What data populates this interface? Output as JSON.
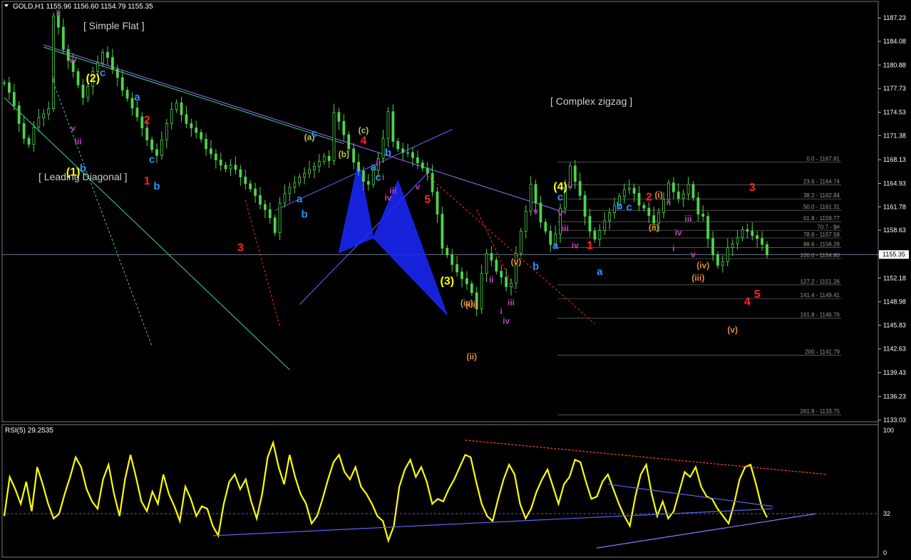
{
  "window": {
    "title": "GOLD,H1  1155.96 1156.60 1154.79 1155.35",
    "arrow_icon": "triangle-down-icon"
  },
  "colors": {
    "background": "#000000",
    "candle_up": "#4dd34d",
    "candle_dn": "#4dd34d",
    "rsi_line": "#ffff00",
    "wave_yellow": "#ffff00",
    "wave_red": "#ff2222",
    "wave_blue": "#2f8fff",
    "wave_magenta": "#c040c0",
    "wave_olive": "#b8c850",
    "wave_orange": "#e09030",
    "trend_green": "#3ad6a0",
    "trend_blue": "#5868ff",
    "trend_violet": "#a070ff",
    "harmonic_fill": "#1a28ff",
    "grid_line": "#606060"
  },
  "chart_data": [
    {
      "type": "candlestick",
      "symbol": "GOLD",
      "timeframe": "H1",
      "ohlc_current": {
        "open": 1155.96,
        "high": 1156.6,
        "low": 1154.79,
        "close": 1155.35
      },
      "ylim": [
        1133.0,
        1188.5
      ],
      "y_ticks": [
        1187.23,
        1184.08,
        1180.88,
        1177.73,
        1174.53,
        1171.38,
        1168.13,
        1164.93,
        1161.78,
        1158.63,
        1155.35,
        1152.18,
        1148.98,
        1145.83,
        1142.63,
        1139.43,
        1136.23,
        1133.03
      ],
      "current_price": 1155.35,
      "closes": [
        1178.5,
        1177.2,
        1175.4,
        1173.0,
        1171.0,
        1170.2,
        1172.5,
        1173.8,
        1174.3,
        1175.0,
        1187.5,
        1186.0,
        1183.0,
        1181.5,
        1180.0,
        1178.2,
        1176.5,
        1178.0,
        1180.0,
        1181.2,
        1182.6,
        1181.9,
        1180.3,
        1179.2,
        1177.5,
        1176.4,
        1175.1,
        1173.9,
        1172.4,
        1170.8,
        1169.5,
        1168.7,
        1170.8,
        1173.0,
        1174.9,
        1175.8,
        1174.2,
        1173.0,
        1172.4,
        1171.8,
        1170.9,
        1169.6,
        1168.9,
        1168.1,
        1167.4,
        1166.9,
        1167.4,
        1166.8,
        1165.8,
        1164.9,
        1164.2,
        1163.3,
        1162.1,
        1161.4,
        1160.3,
        1158.3,
        1162.3,
        1163.6,
        1164.4,
        1165.0,
        1165.8,
        1166.3,
        1166.8,
        1167.2,
        1167.9,
        1168.6,
        1168.0,
        1174.5,
        1173.3,
        1171.5,
        1169.6,
        1167.8,
        1166.6,
        1165.2,
        1164.8,
        1166.7,
        1168.3,
        1171.0,
        1174.6,
        1170.6,
        1169.6,
        1169.1,
        1169.1,
        1168.4,
        1167.7,
        1167.0,
        1166.3,
        1163.8,
        1160.8,
        1156.2,
        1155.3,
        1154.0,
        1153.0,
        1152.1,
        1151.4,
        1150.2,
        1148.0,
        1152.8,
        1155.5,
        1154.6,
        1153.1,
        1152.3,
        1151.0,
        1151.5,
        1155.5,
        1158.5,
        1161.2,
        1164.8,
        1162.3,
        1159.7,
        1158.5,
        1156.7,
        1158.1,
        1161.6,
        1164.5,
        1167.3,
        1165.2,
        1163.3,
        1160.5,
        1158.5,
        1157.4,
        1158.6,
        1159.9,
        1161.0,
        1162.0,
        1163.2,
        1164.1,
        1164.3,
        1163.6,
        1162.0,
        1161.6,
        1160.6,
        1159.6,
        1161.0,
        1162.8,
        1165.0,
        1163.8,
        1162.9,
        1163.5,
        1164.8,
        1163.0,
        1160.8,
        1160.5,
        1157.5,
        1155.3,
        1153.9,
        1154.4,
        1156.3,
        1156.8,
        1157.6,
        1158.7,
        1158.5,
        1157.9,
        1157.5,
        1156.7,
        1155.3
      ],
      "fibonacci": [
        {
          "level": "0.0",
          "price": 1167.81
        },
        {
          "level": "23.6",
          "price": 1164.74
        },
        {
          "level": "38.2",
          "price": 1162.84
        },
        {
          "level": "50.0",
          "price": 1161.31
        },
        {
          "level": "61.8",
          "price": 1159.77
        },
        {
          "level": "70.7",
          "price": 1158.61
        },
        {
          "level": "78.6",
          "price": 1157.58
        },
        {
          "level": "88.6",
          "price": 1156.28
        },
        {
          "level": "100.0",
          "price": 1154.8
        },
        {
          "level": "127.2",
          "price": 1151.26
        },
        {
          "level": "141.4",
          "price": 1149.41
        },
        {
          "level": "161.8",
          "price": 1146.76
        },
        {
          "level": "200",
          "price": 1141.79
        },
        {
          "level": "261.8",
          "price": 1133.75
        }
      ],
      "fib_labels": [
        "0.0 - 1167.81",
        "23.6 - 1164.74",
        "38.2 - 1162.84",
        "50.0 - 1161.31",
        "61.8 - 1159.77",
        "70.7 - $#",
        "78.6 - 1157.58",
        "88.6 - 1156.28",
        "100.0 - 1154.80",
        "127.2 - 1151.26",
        "141.4 - 1149.41",
        "161.8 - 1146.76",
        "200 - 1141.79",
        "261.8 - 1133.75"
      ],
      "text_notes": [
        "[ Simple Flat ]",
        "[ Leading Diagonal ]",
        "[ Complex zigzag ]"
      ],
      "wave_labels": [
        {
          "t": "ii",
          "c": "magenta"
        },
        {
          "t": "iv",
          "c": "magenta"
        },
        {
          "t": "(2)",
          "c": "yellow"
        },
        {
          "t": "c",
          "c": "blue"
        },
        {
          "t": "i",
          "c": "magenta"
        },
        {
          "t": "iii",
          "c": "magenta"
        },
        {
          "t": "b",
          "c": "blue"
        },
        {
          "t": "v",
          "c": "magenta"
        },
        {
          "t": "(1)",
          "c": "yellow"
        },
        {
          "t": "a",
          "c": "blue"
        },
        {
          "t": "2",
          "c": "red"
        },
        {
          "t": "c",
          "c": "blue"
        },
        {
          "t": "b",
          "c": "blue"
        },
        {
          "t": "1",
          "c": "red"
        },
        {
          "t": "3",
          "c": "red"
        },
        {
          "t": "a",
          "c": "blue"
        },
        {
          "t": "b",
          "c": "blue"
        },
        {
          "t": "(a)",
          "c": "olive"
        },
        {
          "t": "c",
          "c": "blue"
        },
        {
          "t": "(b)",
          "c": "olive"
        },
        {
          "t": "4",
          "c": "red"
        },
        {
          "t": "(c)",
          "c": "olive"
        },
        {
          "t": "a",
          "c": "blue"
        },
        {
          "t": "ii",
          "c": "magenta"
        },
        {
          "t": "c",
          "c": "blue"
        },
        {
          "t": "i",
          "c": "magenta"
        },
        {
          "t": "b",
          "c": "blue"
        },
        {
          "t": "iv",
          "c": "magenta"
        },
        {
          "t": "iii",
          "c": "magenta"
        },
        {
          "t": "v",
          "c": "magenta"
        },
        {
          "t": "5",
          "c": "red"
        },
        {
          "t": "(3)",
          "c": "yellow"
        },
        {
          "t": "(iii)",
          "c": "orange"
        },
        {
          "t": "(iv)",
          "c": "orange"
        },
        {
          "t": "(ii)",
          "c": "orange"
        },
        {
          "t": "ii",
          "c": "magenta"
        },
        {
          "t": "i",
          "c": "magenta"
        },
        {
          "t": "iv",
          "c": "magenta"
        },
        {
          "t": "iii",
          "c": "magenta"
        },
        {
          "t": "(v)",
          "c": "orange"
        },
        {
          "t": "v",
          "c": "magenta"
        },
        {
          "t": "b",
          "c": "blue"
        },
        {
          "t": "a",
          "c": "blue"
        },
        {
          "t": "(4)",
          "c": "yellow"
        },
        {
          "t": "c",
          "c": "blue"
        },
        {
          "t": "v",
          "c": "magenta"
        },
        {
          "t": "iii",
          "c": "magenta"
        },
        {
          "t": "ii",
          "c": "magenta"
        },
        {
          "t": "iv",
          "c": "magenta"
        },
        {
          "t": "1",
          "c": "red"
        },
        {
          "t": "a",
          "c": "blue"
        },
        {
          "t": "b",
          "c": "blue"
        },
        {
          "t": "c",
          "c": "blue"
        },
        {
          "t": "2",
          "c": "red"
        },
        {
          "t": "(ii)",
          "c": "orange"
        },
        {
          "t": "(i)",
          "c": "orange"
        },
        {
          "t": "ii",
          "c": "magenta"
        },
        {
          "t": "i",
          "c": "magenta"
        },
        {
          "t": "iv",
          "c": "magenta"
        },
        {
          "t": "iii",
          "c": "magenta"
        },
        {
          "t": "v",
          "c": "magenta"
        },
        {
          "t": "(iii)",
          "c": "orange"
        },
        {
          "t": "(iv)",
          "c": "orange"
        },
        {
          "t": "(v)",
          "c": "orange"
        },
        {
          "t": "4",
          "c": "red"
        },
        {
          "t": "3",
          "c": "red"
        },
        {
          "t": "5",
          "c": "red"
        }
      ]
    },
    {
      "type": "line",
      "indicator": "RSI(5)",
      "title": "RSI(5) 29.2535",
      "current_value": 29.2535,
      "ylim": [
        0,
        100
      ],
      "y_ticks": [
        100,
        32,
        0
      ],
      "level_line": 32,
      "values": [
        30,
        62,
        52,
        40,
        58,
        34,
        70,
        56,
        40,
        28,
        32,
        48,
        62,
        78,
        70,
        52,
        42,
        36,
        60,
        72,
        48,
        30,
        60,
        80,
        62,
        42,
        34,
        50,
        40,
        64,
        48,
        38,
        26,
        54,
        44,
        30,
        38,
        36,
        22,
        14,
        40,
        58,
        64,
        52,
        60,
        42,
        28,
        48,
        78,
        90,
        70,
        56,
        80,
        62,
        48,
        40,
        24,
        30,
        44,
        60,
        74,
        80,
        66,
        60,
        70,
        54,
        48,
        40,
        30,
        26,
        10,
        22,
        54,
        68,
        76,
        62,
        70,
        58,
        40,
        44,
        42,
        52,
        60,
        70,
        80,
        78,
        58,
        40,
        30,
        26,
        44,
        60,
        72,
        64,
        40,
        28,
        36,
        50,
        60,
        68,
        54,
        40,
        56,
        62,
        76,
        74,
        58,
        44,
        46,
        58,
        64,
        52,
        40,
        30,
        22,
        46,
        64,
        72,
        48,
        30,
        42,
        28,
        34,
        50,
        66,
        62,
        70,
        54,
        46,
        44,
        36,
        30,
        24,
        40,
        60,
        70,
        72,
        56,
        38,
        29
      ]
    }
  ]
}
